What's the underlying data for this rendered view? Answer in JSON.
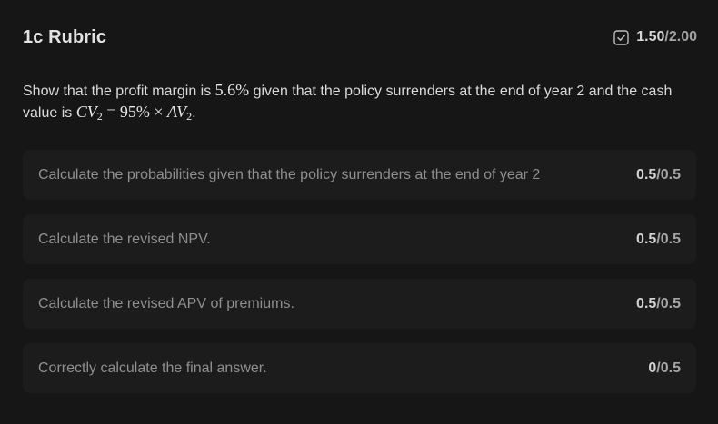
{
  "rubric": {
    "title": "1c Rubric",
    "score": {
      "earned": "1.50",
      "separator": "/",
      "total": "2.00"
    },
    "prompt": {
      "part1": "Show that the profit margin is ",
      "math1": "5.6%",
      "part2": " given that the policy surrenders at the end of year 2 and the cash value is ",
      "math2_a": "CV",
      "math2_a_sub": "2",
      "math2_b": " = 95% × ",
      "math2_c": "AV",
      "math2_c_sub": "2",
      "part3": "."
    },
    "criteria": [
      {
        "label": "Calculate the probabilities given that the policy surrenders at the end of year 2",
        "earned": "0.5",
        "separator": "/",
        "total": "0.5"
      },
      {
        "label": "Calculate the revised NPV.",
        "earned": "0.5",
        "separator": "/",
        "total": "0.5"
      },
      {
        "label": "Calculate the revised APV of premiums.",
        "earned": "0.5",
        "separator": "/",
        "total": "0.5"
      },
      {
        "label": "Correctly calculate the final answer.",
        "earned": "0",
        "separator": "/",
        "total": "0.5"
      }
    ]
  },
  "colors": {
    "background": "#161616",
    "card": "#1c1c1c",
    "title_text": "#e2e2e2",
    "criterion_text": "#8f8f8f"
  },
  "icons": {
    "score": "checkbox-check-icon"
  }
}
